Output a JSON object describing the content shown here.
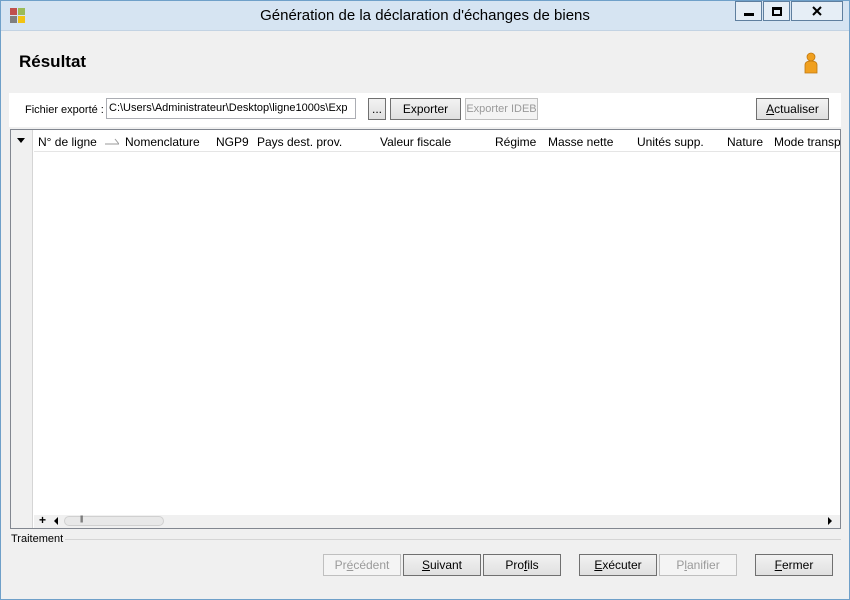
{
  "window": {
    "title": "Génération de la déclaration d'échanges de biens",
    "app_icon": "app-logo-icon",
    "controls": [
      "minimize-icon",
      "maximize-icon",
      "close-icon"
    ]
  },
  "header": {
    "title": "Résultat",
    "user_icon": "person-icon"
  },
  "export": {
    "label": "Fichier exporté :",
    "path": "C:\\Users\\Administrateur\\Desktop\\ligne1000s\\Exp",
    "browse_label": "...",
    "export_label": "Exporter",
    "export_ideb_label": "Exporter IDEB",
    "refresh_label": "Actualiser",
    "refresh_mnemonic": "A"
  },
  "grid": {
    "columns": [
      "N° de ligne",
      "Nomenclature",
      "NGP9",
      "Pays dest. prov.",
      "Valeur fiscale",
      "Régime",
      "Masse nette",
      "Unités supp.",
      "Nature",
      "Mode transp"
    ],
    "rows": [],
    "footer_add": "+"
  },
  "group": {
    "label": "Traitement"
  },
  "buttons": {
    "previous": {
      "pre": "Pr",
      "mn": "é",
      "post": "cédent"
    },
    "next": {
      "pre": "",
      "mn": "S",
      "post": "uivant"
    },
    "profiles": {
      "pre": "Pro",
      "mn": "f",
      "post": "ils"
    },
    "execute": {
      "pre": "",
      "mn": "E",
      "post": "xécuter"
    },
    "schedule": {
      "pre": "P",
      "mn": "l",
      "post": "anifier"
    },
    "close": {
      "pre": "",
      "mn": "F",
      "post": "ermer"
    }
  },
  "colors": {
    "title_bar": "#d6e4f2",
    "window_border": "#6fa0c9",
    "user_icon": "#f0a020"
  }
}
